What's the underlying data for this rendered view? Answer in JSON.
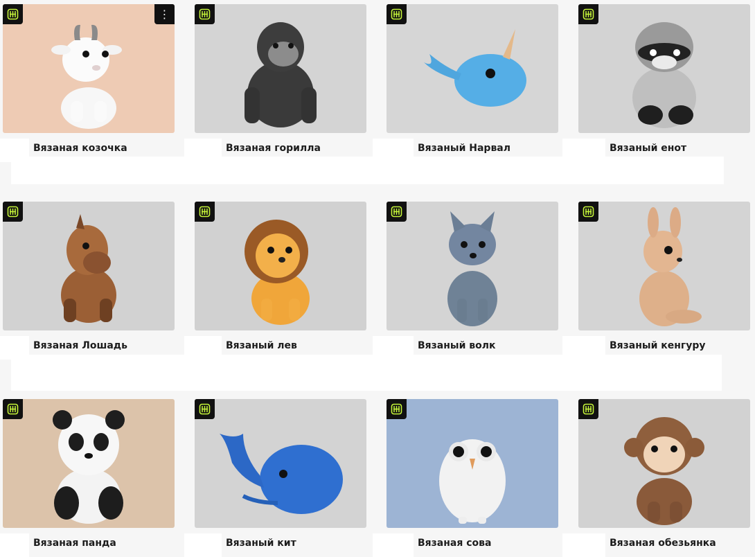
{
  "cards": [
    {
      "title": "Вязаная козочка",
      "bg": "#eecbb4",
      "toy": "goat",
      "has_menu": true
    },
    {
      "title": "Вязаная горилла",
      "bg": "#d4d4d4",
      "toy": "gorilla",
      "has_menu": false
    },
    {
      "title": "Вязаный Нарвал",
      "bg": "#d6d6d6",
      "toy": "narwhal",
      "has_menu": false
    },
    {
      "title": "Вязаный енот",
      "bg": "#d3d3d3",
      "toy": "raccoon",
      "has_menu": false
    },
    {
      "title": "Вязаная Лошадь",
      "bg": "#d2d2d2",
      "toy": "horse",
      "has_menu": false
    },
    {
      "title": "Вязаный лев",
      "bg": "#d1d1d1",
      "toy": "lion",
      "has_menu": false
    },
    {
      "title": "Вязаный волк",
      "bg": "#d4d4d4",
      "toy": "wolf",
      "has_menu": false
    },
    {
      "title": "Вязаный кенгуру",
      "bg": "#d4d4d4",
      "toy": "kangaroo",
      "has_menu": false
    },
    {
      "title": "Вязаная панда",
      "bg": "#dcc3aa",
      "toy": "panda",
      "has_menu": false
    },
    {
      "title": "Вязаный кит",
      "bg": "#d3d3d3",
      "toy": "whale",
      "has_menu": false
    },
    {
      "title": "Вязаная сова",
      "bg": "#9db4d4",
      "toy": "owl",
      "has_menu": false
    },
    {
      "title": "Вязаная обезьянка",
      "bg": "#d2d2d2",
      "toy": "monkey",
      "has_menu": false
    }
  ],
  "menu_glyph": "⋮",
  "badge_icon": "brand-logo-icon",
  "colors": {
    "badge_bg": "#111111",
    "badge_fg": "#c6f53a",
    "text": "#1c1c1c"
  }
}
